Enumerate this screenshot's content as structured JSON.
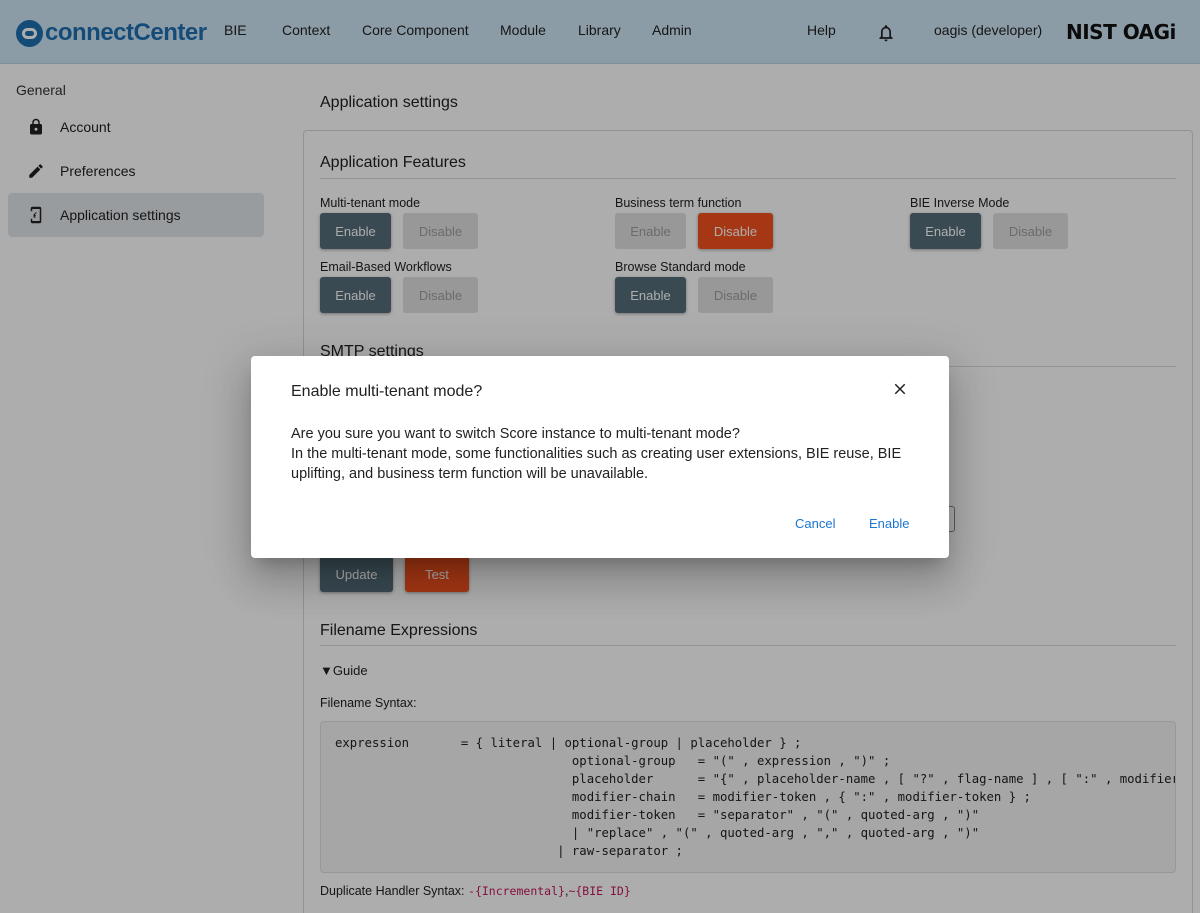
{
  "header": {
    "logo_text": "connectCenter",
    "nav": [
      "BIE",
      "Context",
      "Core Component",
      "Module",
      "Library",
      "Admin"
    ],
    "help": "Help",
    "user": "oagis (developer)",
    "brand": "NIST OAGi"
  },
  "sidebar": {
    "group": "General",
    "items": [
      {
        "label": "Account",
        "icon": "lock-icon"
      },
      {
        "label": "Preferences",
        "icon": "pencil-icon"
      },
      {
        "label": "Application settings",
        "icon": "settings-phone-icon"
      }
    ]
  },
  "main": {
    "title": "Application settings",
    "features_title": "Application Features",
    "features": [
      {
        "label": "Multi-tenant mode",
        "enable": "Enable",
        "disable": "Disable",
        "state": "enabled"
      },
      {
        "label": "Business term function",
        "enable": "Enable",
        "disable": "Disable",
        "state": "disabled"
      },
      {
        "label": "BIE Inverse Mode",
        "enable": "Enable",
        "disable": "Disable",
        "state": "enabled"
      },
      {
        "label": "Email-Based Workflows",
        "enable": "Enable",
        "disable": "Disable",
        "state": "enabled"
      },
      {
        "label": "Browse Standard mode",
        "enable": "Enable",
        "disable": "Disable",
        "state": "enabled"
      }
    ],
    "smtp_title": "SMTP settings",
    "update_label": "Update",
    "test_label": "Test",
    "filename_title": "Filename Expressions",
    "guide_label": "Guide",
    "syntax_label": "Filename Syntax:",
    "syntax_code": "expression       = { literal | optional-group | placeholder } ;\n                                optional-group   = \"(\" , expression , \")\" ;\n                                placeholder      = \"{\" , placeholder-name , [ \"?\" , flag-name ] , [ \":\" , modifier-chain ] , \"}\" ;\n                                modifier-chain   = modifier-token , { \":\" , modifier-token } ;\n                                modifier-token   = \"separator\" , \"(\" , quoted-arg , \")\"\n                                | \"replace\" , \"(\" , quoted-arg , \",\" , quoted-arg , \")\"\n                              | raw-separator ;",
    "dup_label": "Duplicate Handler Syntax:",
    "dup_code_1": "-{Incremental}",
    "dup_sep": ",",
    "dup_code_2": "~{BIE ID}"
  },
  "dialog": {
    "title": "Enable multi-tenant mode?",
    "line1": "Are you sure you want to switch Score instance to multi-tenant mode?",
    "line2": "In the multi-tenant mode, some functionalities such as creating user extensions, BIE reuse, BIE uplifting, and business term function will be unavailable.",
    "cancel": "Cancel",
    "confirm": "Enable"
  },
  "colors": {
    "header_bg": "#cfe6f7",
    "primary_button": "#546e7a",
    "warn_button": "#f4511e",
    "link": "#1976d2"
  }
}
